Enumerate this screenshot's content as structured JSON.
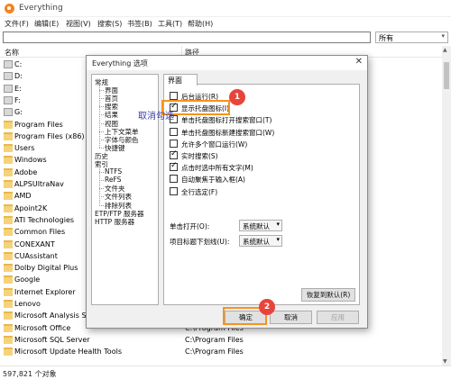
{
  "window": {
    "title": "Everything",
    "menu": [
      "文件(F)",
      "编辑(E)",
      "视图(V)",
      "搜索(S)",
      "书签(B)",
      "工具(T)",
      "帮助(H)"
    ],
    "search_value": "",
    "filter_value": "所有",
    "columns": [
      "名称",
      "路径"
    ],
    "status": "597,821 个对象"
  },
  "files": [
    {
      "name": "C:",
      "path": "",
      "kind": "drive"
    },
    {
      "name": "D:",
      "path": "",
      "kind": "drive"
    },
    {
      "name": "E:",
      "path": "",
      "kind": "drive"
    },
    {
      "name": "F:",
      "path": "",
      "kind": "drive"
    },
    {
      "name": "G:",
      "path": "",
      "kind": "drive"
    },
    {
      "name": "Program Files",
      "path": "",
      "kind": "folder"
    },
    {
      "name": "Program Files (x86)",
      "path": "",
      "kind": "folder"
    },
    {
      "name": "Users",
      "path": "",
      "kind": "folder"
    },
    {
      "name": "Windows",
      "path": "",
      "kind": "folder"
    },
    {
      "name": "Adobe",
      "path": "",
      "kind": "folder"
    },
    {
      "name": "ALPSUltraNav",
      "path": "",
      "kind": "folder"
    },
    {
      "name": "AMD",
      "path": "",
      "kind": "folder"
    },
    {
      "name": "Apoint2K",
      "path": "",
      "kind": "folder"
    },
    {
      "name": "ATI Technologies",
      "path": "",
      "kind": "folder"
    },
    {
      "name": "Common Files",
      "path": "",
      "kind": "folder"
    },
    {
      "name": "CONEXANT",
      "path": "",
      "kind": "folder"
    },
    {
      "name": "CUAssistant",
      "path": "",
      "kind": "folder"
    },
    {
      "name": "Dolby Digital Plus",
      "path": "",
      "kind": "folder"
    },
    {
      "name": "Google",
      "path": "",
      "kind": "folder"
    },
    {
      "name": "Internet Explorer",
      "path": "",
      "kind": "folder"
    },
    {
      "name": "Lenovo",
      "path": "",
      "kind": "folder"
    },
    {
      "name": "Microsoft Analysis Ser",
      "path": "",
      "kind": "folder"
    },
    {
      "name": "Microsoft Office",
      "path": "C:\\Program Files",
      "kind": "folder"
    },
    {
      "name": "Microsoft SQL Server",
      "path": "C:\\Program Files",
      "kind": "folder"
    },
    {
      "name": "Microsoft Update Health Tools",
      "path": "C:\\Program Files",
      "kind": "folder"
    }
  ],
  "dialog": {
    "title": "Everything 选项",
    "close": "✕",
    "tree": [
      {
        "label": "常规",
        "level": 0
      },
      {
        "label": "界面",
        "level": 1
      },
      {
        "label": "首页",
        "level": 1
      },
      {
        "label": "搜索",
        "level": 1
      },
      {
        "label": "结果",
        "level": 1
      },
      {
        "label": "视图",
        "level": 1
      },
      {
        "label": "上下文菜单",
        "level": 1
      },
      {
        "label": "字体与颜色",
        "level": 1
      },
      {
        "label": "快捷键",
        "level": 1
      },
      {
        "label": "历史",
        "level": 0
      },
      {
        "label": "索引",
        "level": 0
      },
      {
        "label": "NTFS",
        "level": 1
      },
      {
        "label": "ReFS",
        "level": 1
      },
      {
        "label": "文件夹",
        "level": 1
      },
      {
        "label": "文件列表",
        "level": 1
      },
      {
        "label": "排除列表",
        "level": 1
      },
      {
        "label": "ETP/FTP 服务器",
        "level": 0
      },
      {
        "label": "HTTP 服务器",
        "level": 0
      }
    ],
    "panel_title": "界面",
    "options": [
      {
        "label": "后台运行(R)",
        "checked": false
      },
      {
        "label": "显示托盘图标(I)",
        "checked": true
      },
      {
        "label": "单击托盘图标打开搜索窗口(T)",
        "checked": false
      },
      {
        "label": "单击托盘图标新建搜索窗口(W)",
        "checked": false
      },
      {
        "label": "允许多个窗口运行(W)",
        "checked": false
      },
      {
        "label": "实时搜索(S)",
        "checked": true
      },
      {
        "label": "点击时选中所有文字(M)",
        "checked": true
      },
      {
        "label": "自动聚焦于输入框(A)",
        "checked": false
      },
      {
        "label": "全行选定(F)",
        "checked": false
      }
    ],
    "single_click": {
      "label": "单击打开(O):",
      "value": "系统默认"
    },
    "underline": {
      "label": "项目标题下划线(U):",
      "value": "系统默认"
    },
    "restore_button": "恢复到默认(R)",
    "ok_button": "确定",
    "cancel_button": "取消",
    "apply_button": "应用"
  },
  "annotations": {
    "badge1": "1",
    "badge2": "2",
    "overlay_text": "取消勾选",
    "highlight_color": "#f7931e",
    "badge_color": "#e8443a"
  }
}
